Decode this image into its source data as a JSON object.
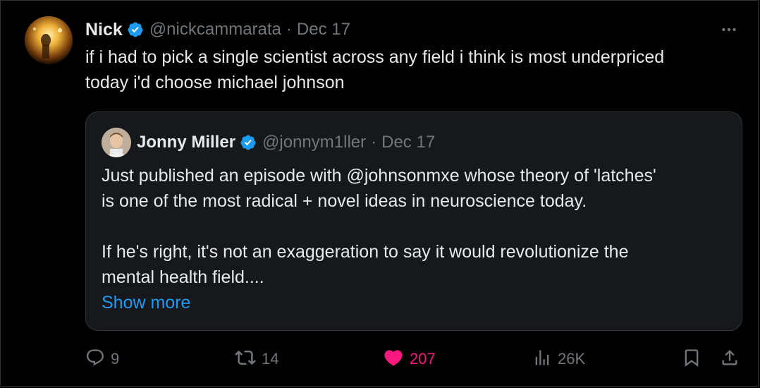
{
  "tweet": {
    "author_name": "Nick",
    "author_handle": "@nickcammarata",
    "separator": "·",
    "date": "Dec 17",
    "text": "if i had to pick a single scientist across any field i think is most underpriced\ntoday i'd choose michael johnson"
  },
  "quote": {
    "author_name": "Jonny Miller",
    "author_handle": "@jonnym1ller",
    "separator": "·",
    "date": "Dec 17",
    "text": "Just published an episode with @johnsonmxe whose theory of 'latches'\nis one of the most radical + novel ideas in neuroscience today.\n\nIf he's right, it's not an exaggeration to say it would revolutionize the\nmental health field....",
    "show_more": "Show more"
  },
  "actions": {
    "replies": "9",
    "reposts": "14",
    "likes": "207",
    "views": "26K"
  },
  "icons": {
    "verified": "verified-badge-icon",
    "more": "more-dots-icon",
    "reply": "reply-icon",
    "repost": "repost-icon",
    "like": "heart-icon",
    "views": "views-chart-icon",
    "bookmark": "bookmark-icon",
    "share": "share-icon"
  },
  "colors": {
    "background": "#000000",
    "quote_background": "#16181c",
    "border": "#2f3336",
    "text": "#e7e9ea",
    "muted": "#71767b",
    "link": "#1d9bf0",
    "like": "#f91880",
    "verified": "#1d9bf0"
  }
}
